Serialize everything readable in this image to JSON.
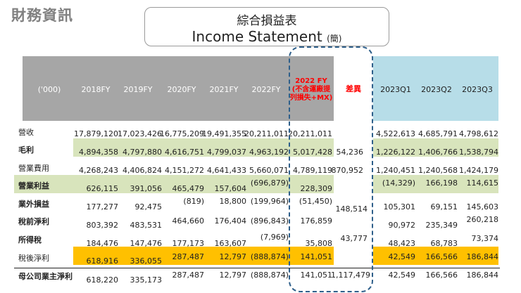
{
  "section_title": "財務資訊",
  "title_zh": "綜合損益表",
  "title_en": "Income Statement",
  "title_en_suffix": "(簡)",
  "headers": {
    "unit": "('000)",
    "y2018": "2018FY",
    "y2019": "2019FY",
    "y2020": "2020FY",
    "y2021": "2021FY",
    "y2022": "2022FY",
    "adj_line1": "2022 FY",
    "adj_line2": "(不含運廠提",
    "adj_line3": "列損失+MX)",
    "diff": "差異",
    "q1": "2023Q1",
    "q2": "2023Q2",
    "q3": "2023Q3"
  },
  "rows": [
    {
      "label": "營收",
      "v2018": "17,879,120",
      "v2019": "17,023,426",
      "v2020": "16,775,209",
      "v2021": "19,491,355",
      "v2022": "20,211,011",
      "vadj": "20,211,011",
      "diff": "",
      "q1": "4,522,613",
      "q2": "4,685,791",
      "q3": "4,798,612"
    },
    {
      "label": "毛利",
      "v2018": "4,894,358",
      "v2019": "4,797,880",
      "v2020": "4,616,751",
      "v2021": "4,799,037",
      "v2022": "4,963,192",
      "vadj": "5,017,428",
      "diff": "54,236",
      "q1": "1,226,122",
      "q2": "1,406,766",
      "q3": "1,538,794"
    },
    {
      "label": "營業費用",
      "v2018": "4,268,243",
      "v2019": "4,406,824",
      "v2020": "4,151,272",
      "v2021": "4,641,433",
      "v2022": "5,660,071",
      "vadj": "4,789,119",
      "diff": "870,952",
      "q1": "1,240,451",
      "q2": "1,240,568",
      "q3": "1,424,179"
    },
    {
      "label": "營業利益",
      "v2018": "626,115",
      "v2019": "391,056",
      "v2020": "465,479",
      "v2021": "157,604",
      "v2022": "(696,879)",
      "vadj": "228,309",
      "diff": "",
      "q1": "(14,329)",
      "q2": "166,198",
      "q3": "114,615"
    },
    {
      "label": "業外損益",
      "v2018": "177,277",
      "v2019": "92,475",
      "v2020": "(819)",
      "v2021": "18,800",
      "v2022": "(199,964)",
      "vadj": "(51,450)",
      "diff": "148,514",
      "q1": "105,301",
      "q2": "69,151",
      "q3": "145,603"
    },
    {
      "label": "稅前淨利",
      "v2018": "803,392",
      "v2019": "483,531",
      "v2020": "464,660",
      "v2021": "176,404",
      "v2022": "(896,843)",
      "vadj": "176,859",
      "diff": "",
      "q1": "90,972",
      "q2": "235,349",
      "q3": "260,218"
    },
    {
      "label": "所得稅",
      "v2018": "184,476",
      "v2019": "147,476",
      "v2020": "177,173",
      "v2021": "163,607",
      "v2022": "(7,969)",
      "vadj": "35,808",
      "diff": "43,777",
      "q1": "48,423",
      "q2": "68,783",
      "q3": "73,374"
    },
    {
      "label": "稅後淨利",
      "v2018": "618,916",
      "v2019": "336,055",
      "v2020": "287,487",
      "v2021": "12,797",
      "v2022": "(888,874)",
      "vadj": "141,051",
      "diff": "",
      "q1": "42,549",
      "q2": "166,566",
      "q3": "186,844"
    },
    {
      "label": "母公司業主淨利",
      "v2018": "618,220",
      "v2019": "335,173",
      "v2020": "287,487",
      "v2021": "12,797",
      "v2022": "(888,874)",
      "vadj": "141,051",
      "diff": "1,117,479",
      "q1": "42,549",
      "q2": "166,566",
      "q3": "186,844"
    }
  ],
  "colors": {
    "header_gray": "#a6a6a6",
    "header_blue": "#b7dde8",
    "highlight_green": "#d8e4bc",
    "highlight_orange": "#ffc000",
    "dashed_outline": "#2e5f8a",
    "adjusted_header_red": "#ff0000"
  }
}
